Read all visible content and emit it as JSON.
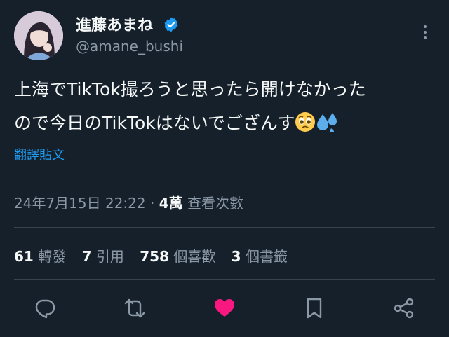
{
  "author": {
    "display_name": "進藤あまね",
    "handle": "@amane_bushi",
    "verified": true
  },
  "tweet": {
    "lines": [
      "上海でTikTok撮ろうと思ったら開けなかった",
      "ので今日のTikTokはないでござんす"
    ],
    "emojis": [
      "pleading-face-emoji",
      "sweat-droplets-emoji"
    ],
    "translate_label": "翻譯貼文"
  },
  "meta": {
    "timestamp": "24年7月15日 22:22",
    "separator": "·",
    "views_count": "4萬",
    "views_label": "查看次數"
  },
  "stats": {
    "retweets": {
      "count": "61",
      "label": "轉發"
    },
    "quotes": {
      "count": "7",
      "label": "引用"
    },
    "likes": {
      "count": "758",
      "label": "個喜歡"
    },
    "bookmarks": {
      "count": "3",
      "label": "個書籤"
    }
  },
  "actions": [
    "reply-icon",
    "retweet-icon",
    "like-icon",
    "bookmark-icon",
    "share-icon"
  ],
  "colors": {
    "background": "#15202b",
    "text": "#f7f9f9",
    "secondary": "#8b98a5",
    "accent": "#1d9bf0",
    "like": "#f91880",
    "divider": "#38444d"
  }
}
